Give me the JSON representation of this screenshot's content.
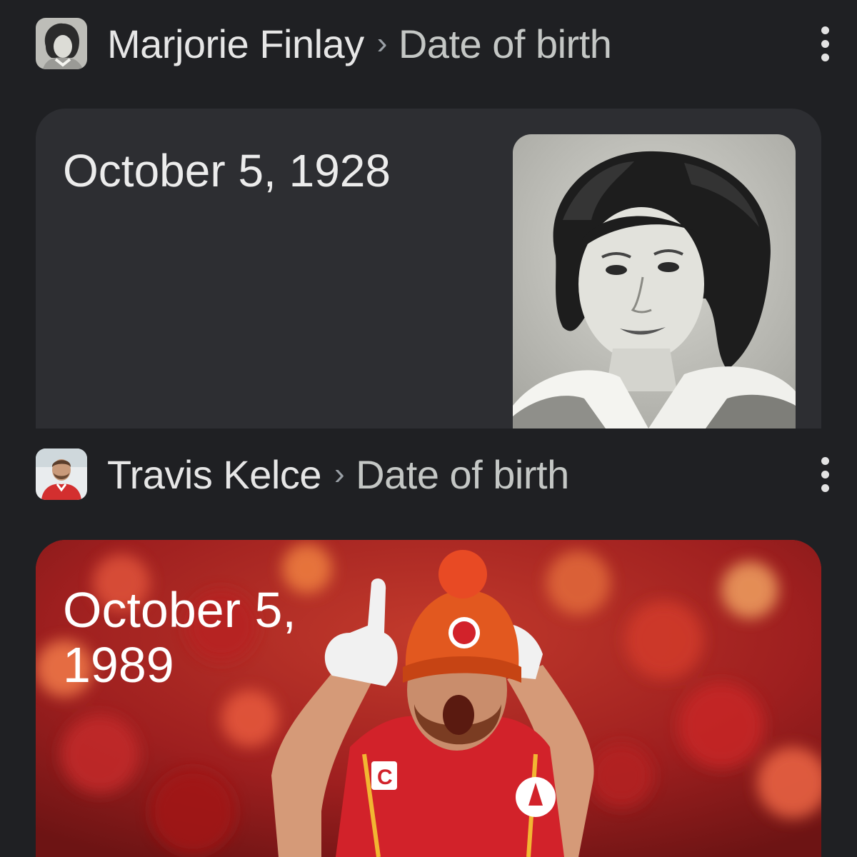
{
  "results": [
    {
      "entity": "Marjorie Finlay",
      "separator": "›",
      "attribute": "Date of birth",
      "value": "October 5, 1928",
      "avatar_icon": "portrait-photo",
      "image": "black-and-white-portrait-of-woman"
    },
    {
      "entity": "Travis Kelce",
      "separator": "›",
      "attribute": "Date of birth",
      "value": "October 5, 1989",
      "avatar_icon": "portrait-photo",
      "image": "football-player-in-red-jersey-pointing"
    }
  ],
  "more_icon": "more-vert-icon",
  "colors": {
    "background": "#1f2023",
    "card": "#2d2e32",
    "text": "#e3e3e3",
    "muted": "#c4c7c5",
    "team_red": "#c8102e",
    "team_gold": "#f2b632"
  }
}
